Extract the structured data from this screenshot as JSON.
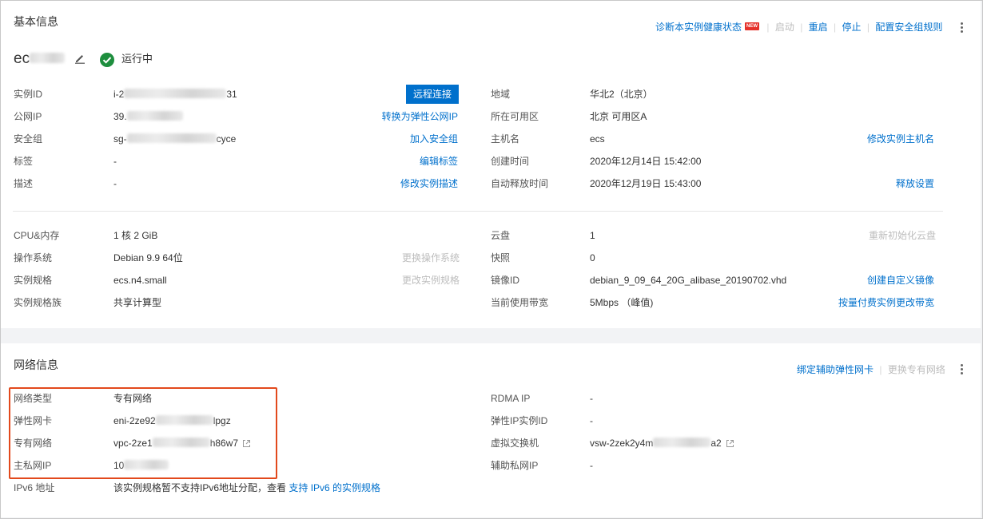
{
  "basic": {
    "title": "基本信息",
    "actions": {
      "diagnose": "诊断本实例健康状态",
      "new_badge": "NEW",
      "start": "启动",
      "restart": "重启",
      "stop": "停止",
      "config_sg": "配置安全组规则",
      "sep": "|"
    },
    "instance_name_prefix": "ec",
    "status": "运行中",
    "remote_connect": "远程连接",
    "left": {
      "instance_id": {
        "label": "实例ID",
        "prefix": "i-2",
        "suffix": "31"
      },
      "public_ip": {
        "label": "公网IP",
        "prefix": "39.",
        "action": "转换为弹性公网IP"
      },
      "security_group": {
        "label": "安全组",
        "prefix": "sg-",
        "suffix": "cyce",
        "action": "加入安全组"
      },
      "tags": {
        "label": "标签",
        "value": "-",
        "action": "编辑标签"
      },
      "description": {
        "label": "描述",
        "value": "-",
        "action": "修改实例描述"
      }
    },
    "right": {
      "region": {
        "label": "地域",
        "value": "华北2（北京）"
      },
      "zone": {
        "label": "所在可用区",
        "value": "北京 可用区A"
      },
      "hostname": {
        "label": "主机名",
        "value": "ecs",
        "action": "修改实例主机名"
      },
      "created": {
        "label": "创建时间",
        "value": "2020年12月14日 15:42:00"
      },
      "auto_release": {
        "label": "自动释放时间",
        "value": "2020年12月19日 15:43:00",
        "action": "释放设置"
      }
    },
    "left2": {
      "cpu_mem": {
        "label": "CPU&内存",
        "value": "1 核 2 GiB"
      },
      "os": {
        "label": "操作系统",
        "value": "Debian 9.9 64位",
        "action": "更换操作系统"
      },
      "spec": {
        "label": "实例规格",
        "value": "ecs.n4.small",
        "action": "更改实例规格"
      },
      "family": {
        "label": "实例规格族",
        "value": "共享计算型"
      }
    },
    "right2": {
      "disk": {
        "label": "云盘",
        "value": "1",
        "action": "重新初始化云盘"
      },
      "snapshot": {
        "label": "快照",
        "value": "0"
      },
      "image": {
        "label": "镜像ID",
        "value": "debian_9_09_64_20G_alibase_20190702.vhd",
        "action": "创建自定义镜像"
      },
      "bandwidth": {
        "label": "当前使用带宽",
        "value": "5Mbps （峰值)",
        "action": "按量付费实例更改带宽"
      }
    }
  },
  "network": {
    "title": "网络信息",
    "actions": {
      "bind_eni": "绑定辅助弹性网卡",
      "sep": "|",
      "change_vpc": "更换专有网络"
    },
    "left": {
      "net_type": {
        "label": "网络类型",
        "value": "专有网络"
      },
      "eni": {
        "label": "弹性网卡",
        "prefix": "eni-2ze92",
        "suffix": "lpgz"
      },
      "vpc": {
        "label": "专有网络",
        "prefix": "vpc-2ze1",
        "suffix": "h86w7"
      },
      "private_ip": {
        "label": "主私网IP",
        "prefix": "10"
      },
      "ipv6": {
        "label": "IPv6 地址",
        "text": "该实例规格暂不支持IPv6地址分配，查看",
        "link": "支持 IPv6 的实例规格"
      }
    },
    "right": {
      "rdma": {
        "label": "RDMA IP",
        "value": "-"
      },
      "eip_id": {
        "label": "弹性IP实例ID",
        "value": "-"
      },
      "vswitch": {
        "label": "虚拟交换机",
        "prefix": "vsw-2zek2y4m",
        "suffix": "a2"
      },
      "secondary_ip": {
        "label": "辅助私网IP",
        "value": "-"
      }
    }
  },
  "colors": {
    "link": "#0070cc",
    "primary": "#0070cc",
    "success": "#1e8e3e",
    "highlight": "#e2491c",
    "badge": "#e5312a"
  }
}
